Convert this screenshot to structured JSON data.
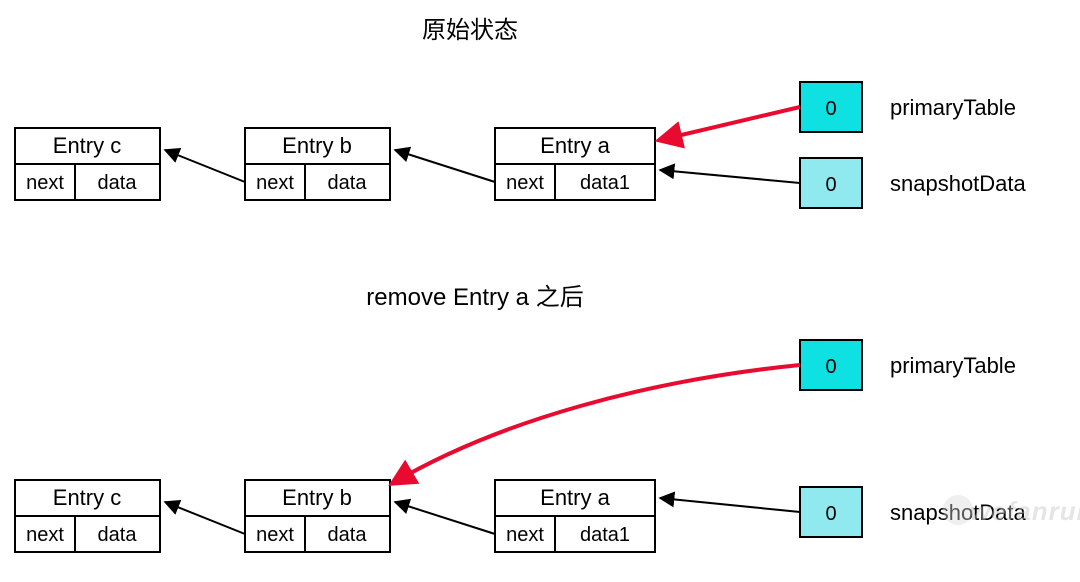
{
  "title1": "原始状态",
  "title2": "remove Entry a 之后",
  "entries": {
    "a": {
      "title": "Entry a",
      "left": "next",
      "right": "data1"
    },
    "b": {
      "title": "Entry b",
      "left": "next",
      "right": "data"
    },
    "c": {
      "title": "Entry c",
      "left": "next",
      "right": "data"
    }
  },
  "slots": {
    "primary": "0",
    "snapshot": "0"
  },
  "labels": {
    "primary": "primaryTable",
    "snapshot": "snapshotData"
  },
  "watermark": "wefanrui",
  "chart_data": [
    {
      "type": "diagram",
      "title": "原始状态",
      "nodes": [
        {
          "id": "primaryTable",
          "kind": "table-slot",
          "value": 0,
          "color": "cyan"
        },
        {
          "id": "snapshotData",
          "kind": "table-slot",
          "value": 0,
          "color": "light-cyan"
        },
        {
          "id": "a",
          "kind": "entry",
          "title": "Entry a",
          "fields": [
            "next",
            "data1"
          ]
        },
        {
          "id": "b",
          "kind": "entry",
          "title": "Entry b",
          "fields": [
            "next",
            "data"
          ]
        },
        {
          "id": "c",
          "kind": "entry",
          "title": "Entry c",
          "fields": [
            "next",
            "data"
          ]
        }
      ],
      "edges": [
        {
          "from": "primaryTable",
          "to": "a",
          "style": "red"
        },
        {
          "from": "snapshotData",
          "to": "a",
          "style": "black"
        },
        {
          "from": "a",
          "to": "b",
          "field": "next",
          "style": "black"
        },
        {
          "from": "b",
          "to": "c",
          "field": "next",
          "style": "black"
        }
      ]
    },
    {
      "type": "diagram",
      "title": "remove Entry a 之后",
      "nodes": [
        {
          "id": "primaryTable",
          "kind": "table-slot",
          "value": 0,
          "color": "cyan"
        },
        {
          "id": "snapshotData",
          "kind": "table-slot",
          "value": 0,
          "color": "light-cyan"
        },
        {
          "id": "a",
          "kind": "entry",
          "title": "Entry a",
          "fields": [
            "next",
            "data1"
          ]
        },
        {
          "id": "b",
          "kind": "entry",
          "title": "Entry b",
          "fields": [
            "next",
            "data"
          ]
        },
        {
          "id": "c",
          "kind": "entry",
          "title": "Entry c",
          "fields": [
            "next",
            "data"
          ]
        }
      ],
      "edges": [
        {
          "from": "primaryTable",
          "to": "b",
          "style": "red"
        },
        {
          "from": "snapshotData",
          "to": "a",
          "style": "black"
        },
        {
          "from": "a",
          "to": "b",
          "field": "next",
          "style": "black"
        },
        {
          "from": "b",
          "to": "c",
          "field": "next",
          "style": "black"
        }
      ]
    }
  ]
}
